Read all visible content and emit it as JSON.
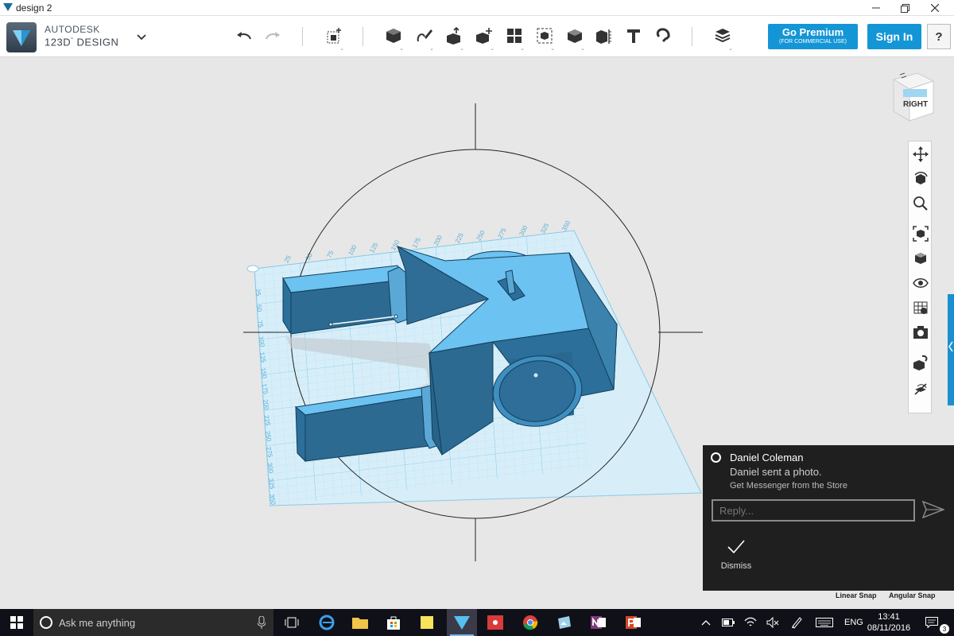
{
  "window": {
    "title": "design 2",
    "controls": [
      "minimize",
      "maximize",
      "close"
    ]
  },
  "brand": {
    "line1": "AUTODESK",
    "line2": "123D",
    "line3": "DESIGN"
  },
  "toolbar": {
    "tools": [
      "undo",
      "redo",
      "primitives",
      "sketch",
      "construct",
      "modify",
      "pattern",
      "grouping",
      "combine",
      "measure",
      "text",
      "snap",
      "material"
    ],
    "premium_label": "Go Premium",
    "premium_sub": "(FOR COMMERCIAL USE)",
    "signin_label": "Sign In",
    "help_label": "?"
  },
  "viewcube": {
    "face_label": "RIGHT"
  },
  "navbar": {
    "items": [
      "pan",
      "orbit",
      "zoom",
      "fit",
      "views",
      "visibility",
      "material-toggle",
      "camera",
      "snap-settings",
      "hide-sketch"
    ]
  },
  "grid_ruler": {
    "top_ticks": [
      "25",
      "50",
      "75",
      "100",
      "125",
      "150",
      "175",
      "200",
      "225",
      "250",
      "275",
      "300",
      "325",
      "350"
    ],
    "left_ticks": [
      "25",
      "50",
      "75",
      "100",
      "125",
      "150",
      "175",
      "200",
      "225",
      "250",
      "275",
      "300",
      "325",
      "350"
    ]
  },
  "status": {
    "linear_snap": "Linear Snap",
    "angular_snap": "Angular Snap"
  },
  "notification": {
    "sender": "Daniel Coleman",
    "message": "Daniel sent a photo.",
    "source": "Get Messenger from the Store",
    "reply_placeholder": "Reply...",
    "dismiss_label": "Dismiss"
  },
  "taskbar": {
    "search_placeholder": "Ask me anything",
    "language": "ENG",
    "time": "13:41",
    "date": "08/11/2016",
    "notification_count": "3"
  },
  "colors": {
    "accent": "#1496d6",
    "model_top": "#6cc2f0",
    "model_side": "#2b6f9a",
    "grid": "#bfe4f5"
  }
}
